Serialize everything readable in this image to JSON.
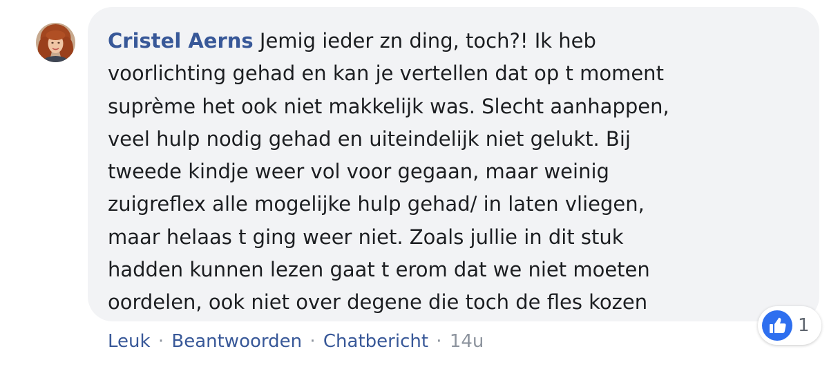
{
  "comment": {
    "author": "Cristel Aerns",
    "lines": [
      "Jemig ieder zn ding, toch?! Ik heb",
      "voorlichting gehad en kan je vertellen dat op t moment",
      "suprème het ook niet makkelijk was. Slecht aanhappen,",
      "veel hulp nodig gehad en uiteindelijk niet gelukt. Bij",
      "tweede kindje weer vol voor gegaan, maar weinig",
      "zuigreflex alle mogelijke hulp gehad/ in laten vliegen,",
      "maar helaas t ging weer niet. Zoals jullie in dit stuk",
      "hadden kunnen lezen gaat t erom dat we niet moeten",
      "oordelen, ook niet over degene die toch de fles kozen"
    ]
  },
  "actions": {
    "like_label": "Leuk",
    "reply_label": "Beantwoorden",
    "message_label": "Chatbericht",
    "separator": "·",
    "timestamp": "14u"
  },
  "reactions": {
    "icon": "like-icon",
    "count": "1"
  },
  "colors": {
    "author": "#385898",
    "bubble": "#f2f3f5",
    "like_blue": "#2e6fef",
    "meta_gray": "#8d949e"
  }
}
